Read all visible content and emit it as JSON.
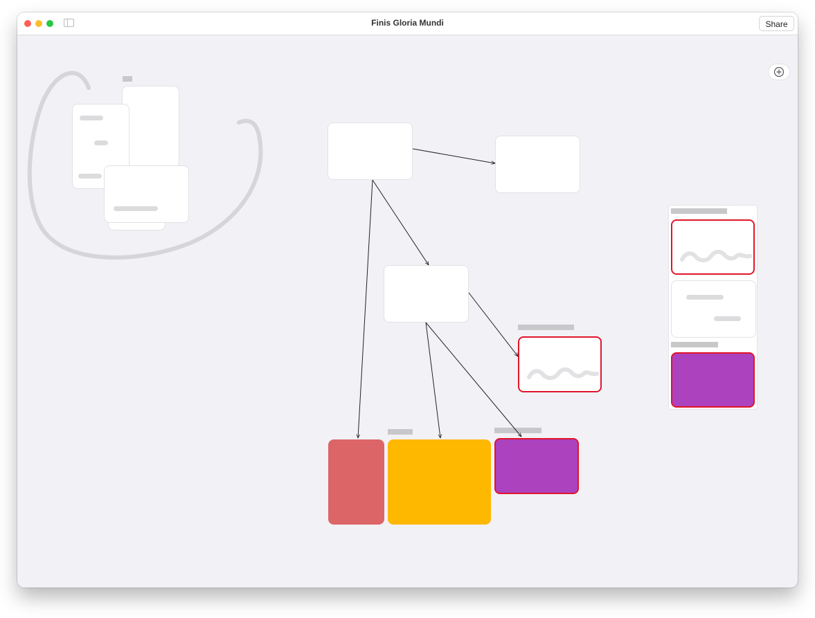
{
  "window": {
    "title": "Finis Gloria Mundi",
    "share_label": "Share"
  },
  "traffic_lights": [
    {
      "name": "close-button",
      "color": "#ff5f57"
    },
    {
      "name": "minimize-button",
      "color": "#febc2e"
    },
    {
      "name": "zoom-button",
      "color": "#28c840"
    }
  ],
  "icons": {
    "sidebar": "sidebar-toggle-icon",
    "add": "plus-circle-icon"
  },
  "colors": {
    "canvas_bg": "#f1f1f6",
    "selection": "#e0152a",
    "card_red": "#dc6568",
    "card_yellow": "#ffb800",
    "card_purple": "#ad42bf",
    "connector": "#222222"
  }
}
